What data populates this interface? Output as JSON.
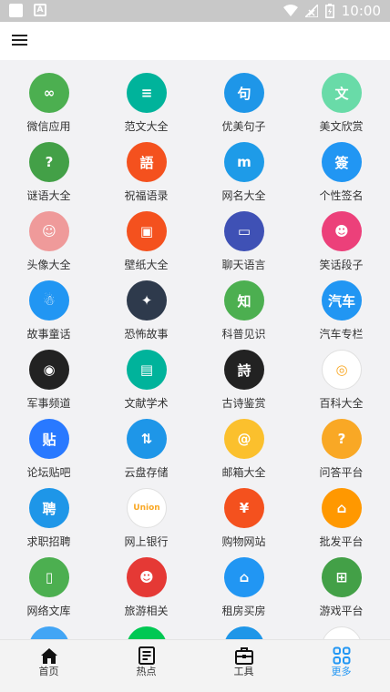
{
  "status_bar": {
    "time": "10:00"
  },
  "bottom_nav": [
    {
      "label": "首页",
      "icon": "home-icon",
      "active": false
    },
    {
      "label": "热点",
      "icon": "news-icon",
      "active": false
    },
    {
      "label": "工具",
      "icon": "toolbox-icon",
      "active": false
    },
    {
      "label": "更多",
      "icon": "grid-more-icon",
      "active": true
    }
  ],
  "colors": {
    "active": "#2196f3"
  },
  "apps": [
    {
      "label": "微信应用",
      "icon": "wechat-apps-icon",
      "color": "#4caf50",
      "glyph": "∞"
    },
    {
      "label": "范文大全",
      "icon": "document-icon",
      "color": "#00b39b",
      "glyph": "≡"
    },
    {
      "label": "优美句子",
      "icon": "quote-icon",
      "color": "#1e96e8",
      "glyph": "句"
    },
    {
      "label": "美文欣赏",
      "icon": "wen-icon",
      "color": "#69dba8",
      "glyph": "文"
    },
    {
      "label": "谜语大全",
      "icon": "riddle-icon",
      "color": "#43a047",
      "glyph": "?"
    },
    {
      "label": "祝福语录",
      "icon": "blessing-icon",
      "color": "#f4511e",
      "glyph": "語"
    },
    {
      "label": "网名大全",
      "icon": "nickname-icon",
      "color": "#1e9be8",
      "glyph": "m"
    },
    {
      "label": "个性签名",
      "icon": "signature-icon",
      "color": "#2196f3",
      "glyph": "簽"
    },
    {
      "label": "头像大全",
      "icon": "avatar-icon",
      "color": "#ef9a9a",
      "glyph": "☺"
    },
    {
      "label": "壁纸大全",
      "icon": "wallpaper-icon",
      "color": "#f4511e",
      "glyph": "▣"
    },
    {
      "label": "聊天语言",
      "icon": "chat-icon",
      "color": "#3f51b5",
      "glyph": "▭"
    },
    {
      "label": "笑话段子",
      "icon": "joke-icon",
      "color": "#ec407a",
      "glyph": "☻"
    },
    {
      "label": "故事童话",
      "icon": "story-icon",
      "color": "#2196f3",
      "glyph": "☃"
    },
    {
      "label": "恐怖故事",
      "icon": "horror-icon",
      "color": "#2e3a4c",
      "glyph": "✦"
    },
    {
      "label": "科普见识",
      "icon": "science-icon",
      "color": "#4caf50",
      "glyph": "知"
    },
    {
      "label": "汽车专栏",
      "icon": "car-icon",
      "color": "#2196f3",
      "glyph": "汽车"
    },
    {
      "label": "军事频道",
      "icon": "military-icon",
      "color": "#222222",
      "glyph": "◉"
    },
    {
      "label": "文献学术",
      "icon": "literature-icon",
      "color": "#00b39b",
      "glyph": "▤"
    },
    {
      "label": "古诗鉴赏",
      "icon": "poetry-icon",
      "color": "#222222",
      "glyph": "詩"
    },
    {
      "label": "百科大全",
      "icon": "encyclopedia-icon",
      "color": "#ffffff",
      "glyph": "◎"
    },
    {
      "label": "论坛贴吧",
      "icon": "forum-icon",
      "color": "#2979ff",
      "glyph": "贴"
    },
    {
      "label": "云盘存储",
      "icon": "cloud-storage-icon",
      "color": "#1e96e8",
      "glyph": "⇅"
    },
    {
      "label": "邮箱大全",
      "icon": "mail-icon",
      "color": "#fbc02d",
      "glyph": "@"
    },
    {
      "label": "问答平台",
      "icon": "qa-icon",
      "color": "#f9a825",
      "glyph": "?"
    },
    {
      "label": "求职招聘",
      "icon": "job-icon",
      "color": "#1e96e8",
      "glyph": "聘"
    },
    {
      "label": "网上银行",
      "icon": "bank-icon",
      "color": "#ffffff",
      "glyph": "Union"
    },
    {
      "label": "购物网站",
      "icon": "shopping-icon",
      "color": "#f4511e",
      "glyph": "¥"
    },
    {
      "label": "批发平台",
      "icon": "wholesale-icon",
      "color": "#ff9800",
      "glyph": "⌂"
    },
    {
      "label": "网络文库",
      "icon": "library-icon",
      "color": "#4caf50",
      "glyph": "▯"
    },
    {
      "label": "旅游相关",
      "icon": "travel-icon",
      "color": "#e53935",
      "glyph": "☻"
    },
    {
      "label": "租房买房",
      "icon": "house-icon",
      "color": "#2196f3",
      "glyph": "⌂"
    },
    {
      "label": "游戏平台",
      "icon": "game-icon",
      "color": "#43a047",
      "glyph": "⊞"
    }
  ]
}
